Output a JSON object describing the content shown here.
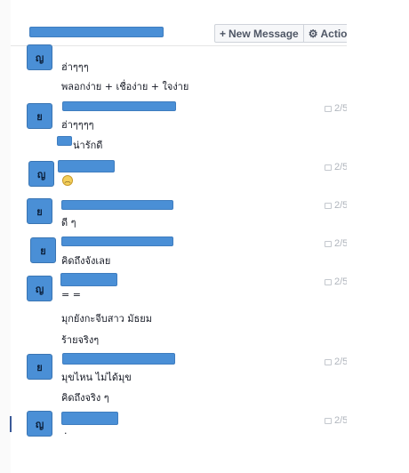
{
  "toolbar": {
    "new_message": {
      "icon": "plus-icon",
      "glyph": "+",
      "label": "New Message"
    },
    "actions": {
      "icon": "gear-icon",
      "glyph": "⚙",
      "label": "Action"
    }
  },
  "conversation": [
    {
      "avatar": "ญ",
      "lines": [
        "ฮ่าๆๆๆ",
        "พลอกง่าย + เชื่อง่าย + ใจง่าย"
      ],
      "time": ""
    },
    {
      "avatar": "ย",
      "lines": [
        "ฮ่าๆๆๆๆ",
        "น่ารักดี"
      ],
      "time": "2/5"
    },
    {
      "avatar": "ญ",
      "lines": [],
      "time": "2/5"
    },
    {
      "avatar": "ย",
      "lines": [
        "ดี ๆ"
      ],
      "time": "2/5"
    },
    {
      "avatar": "ย",
      "lines": [
        "คิดถึงจังเลย"
      ],
      "time": "2/5"
    },
    {
      "avatar": "ญ",
      "lines": [
        "= =",
        "มุกยังกะจีบสาว มัธยม",
        "ร้ายจริงๆ"
      ],
      "time": "2/5"
    },
    {
      "avatar": "ย",
      "lines": [
        "มุขไหน ไม่ได้มุข",
        "คิดถึงจริง ๆ"
      ],
      "time": "2/5"
    },
    {
      "avatar": "ญ",
      "lines": [
        "."
      ],
      "time": "2/5"
    }
  ],
  "colors": {
    "redaction": "#4a8fd6",
    "timestamp": "#b0b5bd",
    "button_text": "#4e5665"
  }
}
